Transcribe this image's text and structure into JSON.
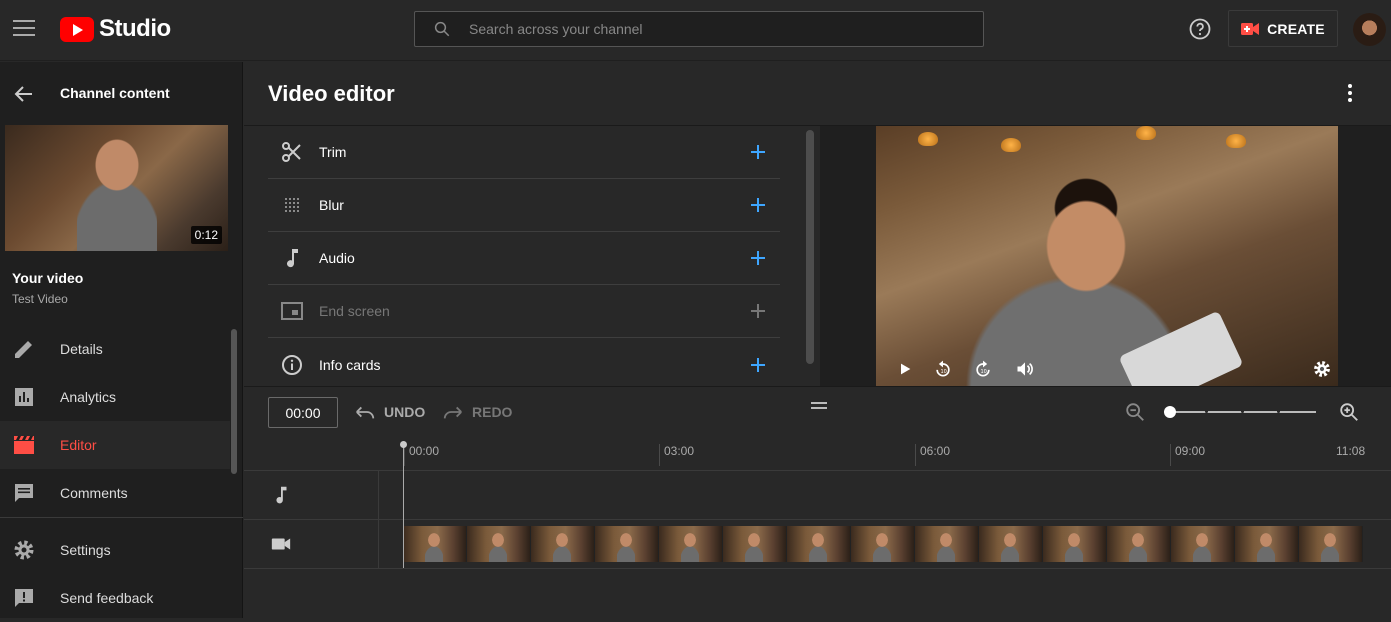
{
  "topbar": {
    "logo_text": "Studio",
    "search_placeholder": "Search across your channel",
    "create_label": "CREATE",
    "brand_color": "#ff0000"
  },
  "sidebar": {
    "channel_content": "Channel content",
    "thumb_duration": "0:12",
    "your_video": "Your video",
    "video_title": "Test Video",
    "items": [
      {
        "label": "Details",
        "icon": "pencil-icon"
      },
      {
        "label": "Analytics",
        "icon": "analytics-icon"
      },
      {
        "label": "Editor",
        "icon": "editor-icon",
        "active": true
      },
      {
        "label": "Comments",
        "icon": "comments-icon"
      },
      {
        "label": "Settings",
        "icon": "gear-icon"
      },
      {
        "label": "Send feedback",
        "icon": "feedback-icon"
      }
    ],
    "active_color": "#ff4e45"
  },
  "editor": {
    "title": "Video editor",
    "tools": [
      {
        "label": "Trim",
        "icon": "scissors-icon",
        "enabled": true
      },
      {
        "label": "Blur",
        "icon": "blur-icon",
        "enabled": true
      },
      {
        "label": "Audio",
        "icon": "music-note-icon",
        "enabled": true
      },
      {
        "label": "End screen",
        "icon": "end-screen-icon",
        "enabled": false
      },
      {
        "label": "Info cards",
        "icon": "info-icon",
        "enabled": true
      }
    ],
    "accent_color": "#3ea6ff"
  },
  "timeline": {
    "current_time": "00:00",
    "undo_label": "UNDO",
    "redo_label": "REDO",
    "ticks": [
      "00:00",
      "03:00",
      "06:00",
      "09:00",
      "11:08"
    ],
    "frame_count": 15
  }
}
